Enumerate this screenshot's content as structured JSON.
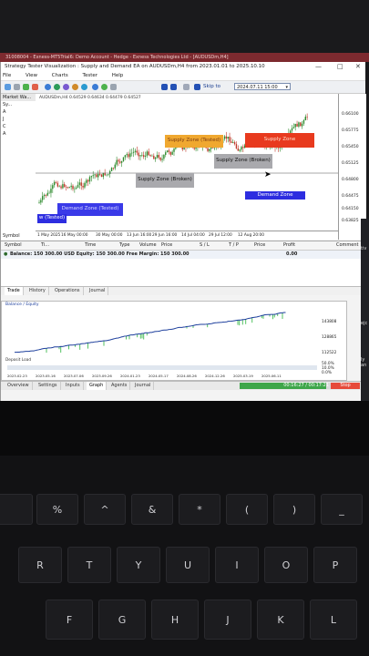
{
  "system_title": "31008004 - Exness-MT5Trial6: Demo Account - Hedge - Exness Technologies Ltd - [AUDUSDm,H4]",
  "window": {
    "title": "Strategy Tester Visualization : Supply and Demand EA on AUDUSDm,H4 from 2023.01.01 to 2025.10.10",
    "minimize": "—",
    "maximize": "□",
    "close": "✕"
  },
  "menu": [
    "File",
    "View",
    "Charts",
    "Tester",
    "Help"
  ],
  "toolbar": {
    "skip_label": "Skip to",
    "skip_date": "2024.07.11 15:00"
  },
  "left_panel": {
    "title": "Market Wa...",
    "items": [
      "Sy...",
      "A",
      "J",
      "C",
      "A"
    ],
    "symbol_label": "Symbol"
  },
  "chart": {
    "header": "AUDUSDm,H4  0.64529  0.64634  0.64479  0.64527",
    "price_ticks": [
      "0.66100",
      "0.65775",
      "0.65450",
      "0.65125",
      "0.64800",
      "0.64475",
      "0.64150",
      "0.63825"
    ],
    "time_ticks": [
      "1 May 2025",
      "16 May 00:00",
      "30 May 00:00",
      "13 Jun 16:00",
      "29 Jun 16:00",
      "14 Jul 04:00",
      "29 Jul 12:00",
      "12 Aug 20:00"
    ],
    "zones": {
      "supply_tested": "Supply Zone (Tested)",
      "supply": "Supply Zone",
      "supply_broken_right": "Supply Zone (Broken)",
      "supply_broken_mid": "Supply Zone (Broken)",
      "demand_tested": "Demand Zone (Tested)",
      "demand_left": "w (Tested)",
      "demand_right": "Demand Zone"
    },
    "colors": {
      "supply": "#e83a1e",
      "supply_tested": "#f0a830",
      "broken": "#a9a9ad",
      "demand": "#2d2de0",
      "up_candle": "#2e8b2e",
      "down_candle": "#c0392b"
    }
  },
  "positions": {
    "columns": [
      "Symbol",
      "Ti...",
      "Time",
      "Type",
      "Volume",
      "Price",
      "S / L",
      "T / P",
      "Price",
      "Profit",
      "Comment"
    ],
    "balance_text": "Balance: 150 300.00 USD  Equity: 150 300.00  Free Margin: 150 300.00",
    "profit": "0.00"
  },
  "tabs_top": [
    "Trade",
    "History",
    "Operations",
    "Journal"
  ],
  "graph": {
    "legend": "Balance / Equity",
    "y_ticks": [
      "143808",
      "128865",
      "112522"
    ],
    "deposit_label": "Deposit Load",
    "x_ticks": [
      "2023.02.23",
      "2023.05.16",
      "2023.07.06",
      "2023.09.26",
      "2024.01.23",
      "2024.05.17",
      "2024.08.26",
      "2024.12.26",
      "2025.03.19",
      "2025.06.11"
    ],
    "load_ticks": [
      "50.0%",
      "10.0%",
      "0.0%"
    ]
  },
  "tabs_bottom": [
    "Overview",
    "Settings",
    "Inputs",
    "Graph",
    "Agents",
    "Journal"
  ],
  "progress": {
    "text": "00:16:27 / 00:17:21",
    "fraction": 0.95
  },
  "stop_label": "Stop",
  "right_strip": [
    "tiv",
    "ejc",
    "ly an"
  ],
  "keyboard": {
    "row1": [
      "%",
      "^",
      "&",
      "*",
      "(",
      ")",
      "_"
    ],
    "row1_sub": [
      "5",
      "6",
      "7",
      "8",
      "9",
      "0",
      "-"
    ],
    "row2": [
      "R",
      "T",
      "Y",
      "U",
      "I",
      "O",
      "P"
    ],
    "row3": [
      "F",
      "G",
      "H",
      "J",
      "K",
      "L"
    ]
  }
}
